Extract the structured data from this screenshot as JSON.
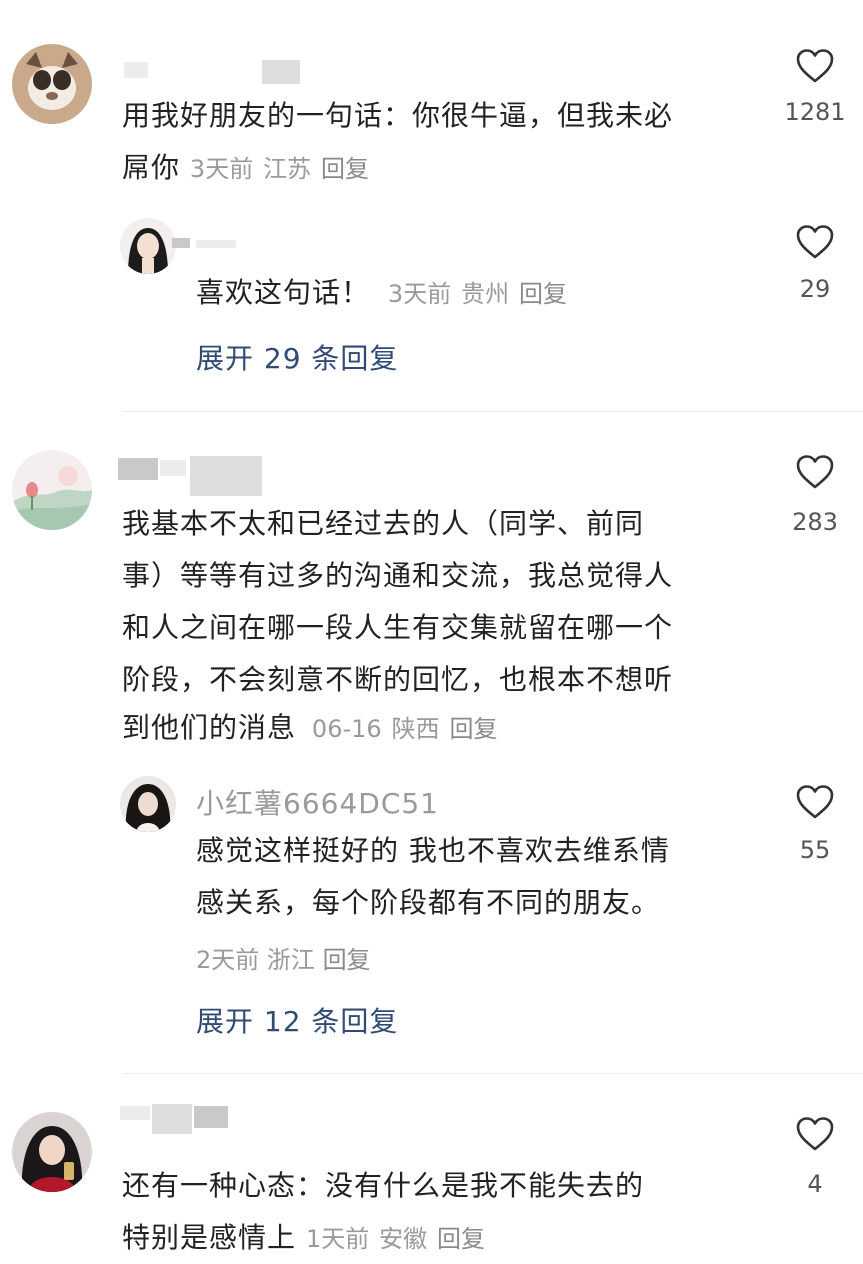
{
  "comments": [
    {
      "text_line1": "用我好朋友的一句话：你很牛逼，但我未必",
      "text_line2": "屌你",
      "date": "3天前",
      "location": "江苏",
      "reply_label": "回复",
      "likes": "1281",
      "reply": {
        "text": "喜欢这句话！",
        "date": "3天前",
        "location": "贵州",
        "reply_label": "回复",
        "likes": "29"
      },
      "expand_label": "展开 29 条回复"
    },
    {
      "lines": [
        "我基本不太和已经过去的人（同学、前同",
        "事）等等有过多的沟通和交流，我总觉得人",
        "和人之间在哪一段人生有交集就留在哪一个",
        "阶段，不会刻意不断的回忆，也根本不想听"
      ],
      "last_line": "到他们的消息",
      "date": "06-16",
      "location": "陕西",
      "reply_label": "回复",
      "likes": "283",
      "reply": {
        "username": "小红薯6664DC51",
        "line1": "感觉这样挺好的 我也不喜欢去维系情",
        "line2": "感关系，每个阶段都有不同的朋友。",
        "date": "2天前",
        "location": "浙江",
        "reply_label": "回复",
        "likes": "55"
      },
      "expand_label": "展开 12 条回复"
    },
    {
      "text_line1": "还有一种心态：没有什么是我不能失去的",
      "text_line2": "特别是感情上",
      "date": "1天前",
      "location": "安徽",
      "reply_label": "回复",
      "likes": "4"
    }
  ],
  "colors": {
    "text": "#222222",
    "meta": "#9a9a9a",
    "expand_link": "#2f4b76",
    "divider": "#ececec"
  }
}
